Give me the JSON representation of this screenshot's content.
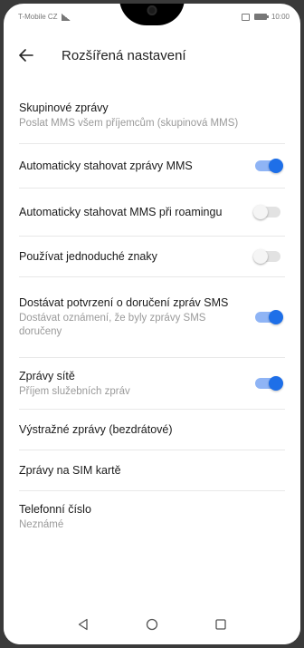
{
  "status": {
    "carrier": "T-Mobile CZ",
    "time": "10:00"
  },
  "header": {
    "title": "Rozšířená nastavení"
  },
  "items": [
    {
      "title": "Skupinové zprávy",
      "subtitle": "Poslat MMS všem příjemcům (skupinová MMS)",
      "toggle": null
    },
    {
      "title": "Automaticky stahovat zprávy MMS",
      "subtitle": "",
      "toggle": true
    },
    {
      "title": "Automaticky stahovat MMS při roamingu",
      "subtitle": "",
      "toggle": false
    },
    {
      "title": "Používat jednoduché znaky",
      "subtitle": "",
      "toggle": false
    },
    {
      "title": "Dostávat potvrzení o doručení zpráv SMS",
      "subtitle": "Dostávat oznámení, že byly zprávy SMS doručeny",
      "toggle": true
    },
    {
      "title": "Zprávy sítě",
      "subtitle": "Příjem služebních zpráv",
      "toggle": true
    },
    {
      "title": "Výstražné zprávy (bezdrátové)",
      "subtitle": "",
      "toggle": null
    },
    {
      "title": "Zprávy na SIM kartě",
      "subtitle": "",
      "toggle": null
    },
    {
      "title": "Telefonní číslo",
      "subtitle": "Neznámé",
      "toggle": null
    }
  ],
  "colors": {
    "accent": "#1e6fe8",
    "accent_track": "#8fb4f5"
  },
  "navbar": {
    "back": "back-triangle-icon",
    "home": "home-circle-icon",
    "recents": "recents-square-icon"
  }
}
